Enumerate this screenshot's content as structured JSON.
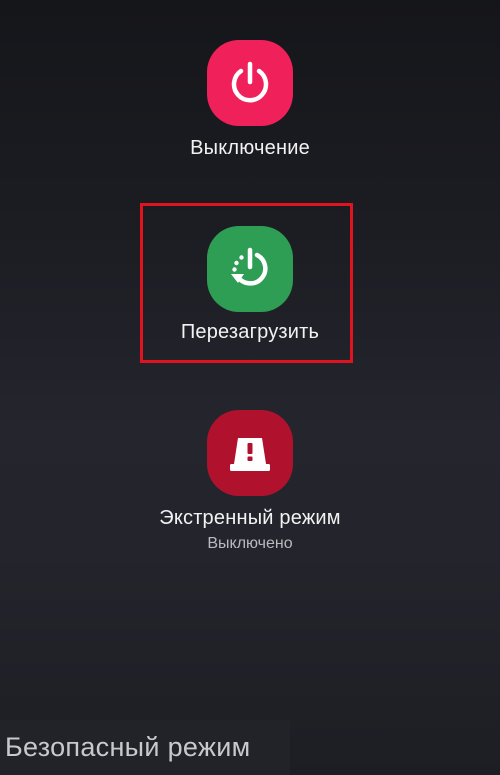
{
  "power_menu": {
    "power_off": {
      "label": "Выключение",
      "icon": "power-icon",
      "color": "#f0205a"
    },
    "restart": {
      "label": "Перезагрузить",
      "icon": "restart-icon",
      "color": "#2e9e55",
      "highlight_color": "#e0141e"
    },
    "emergency": {
      "label": "Экстренный режим",
      "status": "Выключено",
      "icon": "emergency-siren-icon",
      "color": "#b0122e"
    }
  },
  "safe_mode": {
    "label": "Безопасный режим"
  }
}
